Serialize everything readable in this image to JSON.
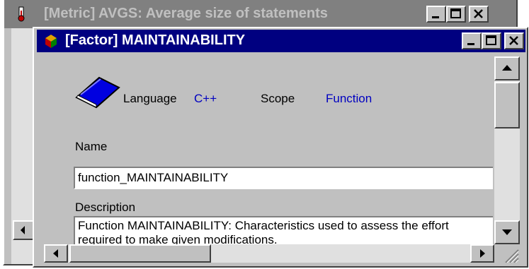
{
  "background_window": {
    "title": "[Metric] AVGS: Average size of statements",
    "icon": "thermometer-icon"
  },
  "window": {
    "title": "[Factor] MAINTAINABILITY",
    "icon": "factor-icon",
    "title_bar_color": "#000080"
  },
  "header": {
    "book_icon": "book-icon",
    "language_label": "Language",
    "language_value": "C++",
    "scope_label": "Scope",
    "scope_value": "Function",
    "value_color": "#0000c0"
  },
  "form": {
    "name_label": "Name",
    "name_value": "function_MAINTAINABILITY",
    "description_label": "Description",
    "description_value": "Function MAINTAINABILITY: Characteristics used to assess the effort required to make given modifications."
  }
}
